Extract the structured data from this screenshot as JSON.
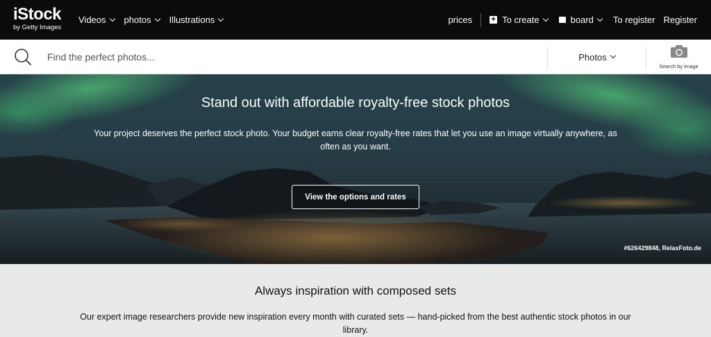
{
  "logo": {
    "main": "iStock",
    "sub": "by Getty Images"
  },
  "nav": {
    "left": [
      {
        "label": "Videos"
      },
      {
        "label": "photos"
      },
      {
        "label": "Illustrations"
      }
    ],
    "prices": "prices",
    "create": "To create",
    "board": "board",
    "register": "To register",
    "signin": "Register"
  },
  "search": {
    "placeholder": "Find the perfect photos...",
    "type": "Photos",
    "image_search_label": "Search by image"
  },
  "hero": {
    "title": "Stand out with affordable royalty-free stock photos",
    "text": "Your project deserves the perfect stock photo. Your budget earns clear royalty-free rates that let you use an image virtually anywhere, as often as you want.",
    "button": "View the options and rates",
    "credit": "#626429848, RelaxFoto.de"
  },
  "section": {
    "title": "Always inspiration with composed sets",
    "text": "Our expert image researchers provide new inspiration every month with curated sets — hand-picked from the best authentic stock photos in our library."
  },
  "colors": {
    "nav_bg": "#0b0b0b",
    "accent": "#ffffff",
    "section_bg": "#e8eaea"
  }
}
